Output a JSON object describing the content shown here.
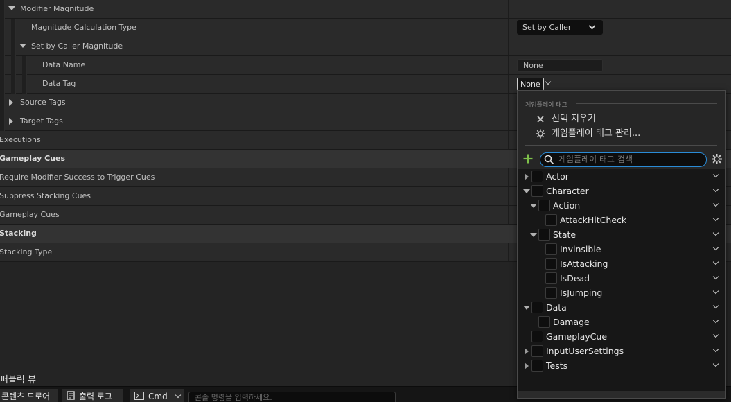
{
  "details": {
    "rows": [
      {
        "label": "Modifier Magnitude"
      },
      {
        "label": "Magnitude Calculation Type",
        "value": "Set by Caller"
      },
      {
        "label": "Set by Caller Magnitude"
      },
      {
        "label": "Data Name",
        "value": "None"
      },
      {
        "label": "Data Tag",
        "value": "None"
      },
      {
        "label": "Source Tags"
      },
      {
        "label": "Target Tags"
      },
      {
        "label": "Executions"
      },
      {
        "label": "Gameplay Cues"
      },
      {
        "label": "Require Modifier Success to Trigger Cues"
      },
      {
        "label": "Suppress Stacking Cues"
      },
      {
        "label": "Gameplay Cues"
      },
      {
        "label": "Stacking"
      },
      {
        "label": "Stacking Type"
      }
    ]
  },
  "bottom": {
    "public_view": "퍼블릭 뷰",
    "tabs": {
      "content_drawer": "콘텐츠 드로어",
      "output_log": "출력 로그",
      "cmd": "Cmd"
    },
    "console_placeholder": "콘솔 명령을 입력하세요."
  },
  "popup": {
    "section_title": "게임플레이 태그",
    "clear_selection": "선택 지우기",
    "manage_tags": "게임플레이 태그 관리...",
    "search_placeholder": "게임플레이 태그 검색",
    "tree": [
      {
        "label": "Actor",
        "expand": "collapsed"
      },
      {
        "label": "Character",
        "expand": "expanded"
      },
      {
        "label": "Action",
        "expand": "expanded"
      },
      {
        "label": "AttackHitCheck",
        "expand": "leaf"
      },
      {
        "label": "State",
        "expand": "expanded"
      },
      {
        "label": "Invinsible",
        "expand": "leaf"
      },
      {
        "label": "IsAttacking",
        "expand": "leaf"
      },
      {
        "label": "IsDead",
        "expand": "leaf"
      },
      {
        "label": "IsJumping",
        "expand": "leaf"
      },
      {
        "label": "Data",
        "expand": "expanded"
      },
      {
        "label": "Damage",
        "expand": "leaf"
      },
      {
        "label": "GameplayCue",
        "expand": "leaf"
      },
      {
        "label": "InputUserSettings",
        "expand": "collapsed"
      },
      {
        "label": "Tests",
        "expand": "collapsed"
      }
    ]
  },
  "colors": {
    "accent": "#2a8bd6",
    "add": "#7ec04a"
  }
}
